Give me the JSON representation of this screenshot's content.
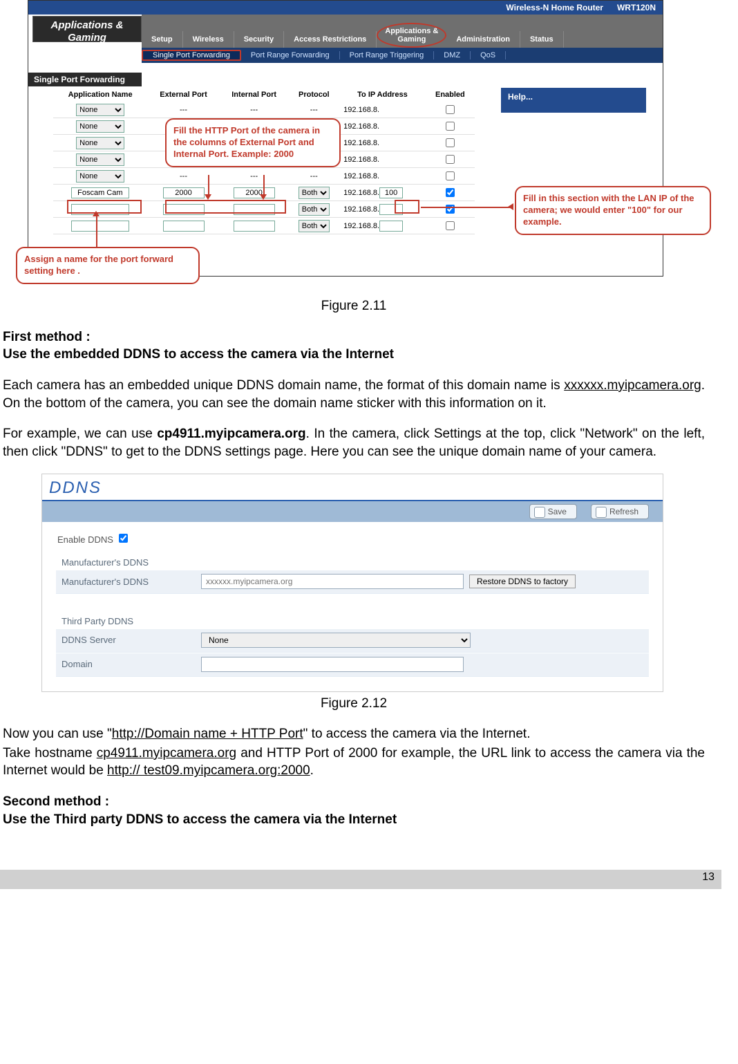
{
  "router": {
    "product_line": "Wireless-N Home Router",
    "model": "WRT120N",
    "section_title": "Applications & Gaming",
    "main_tabs": [
      "Setup",
      "Wireless",
      "Security",
      "Access Restrictions",
      "Applications &\nGaming",
      "Administration",
      "Status"
    ],
    "main_tab_active": 4,
    "sub_tabs": [
      "Single Port Forwarding",
      "Port Range Forwarding",
      "Port Range Triggering",
      "DMZ",
      "QoS"
    ],
    "sub_tab_active": 0,
    "panel_title": "Single Port Forwarding",
    "help_label": "Help...",
    "columns": [
      "Application Name",
      "External Port",
      "Internal Port",
      "Protocol",
      "To IP Address",
      "Enabled"
    ],
    "none_option": "None",
    "dash": "---",
    "both_option": "Both",
    "ip_prefix": "192.168.8.",
    "rows": {
      "none_count": 5,
      "custom": {
        "name": "Foscam Cam",
        "ext_port": "2000",
        "int_port": "2000",
        "protocol": "Both",
        "ip_end": "100",
        "enabled": true
      },
      "extra": [
        {
          "protocol": "Both",
          "enabled": true
        },
        {
          "protocol": "Both",
          "enabled": false
        }
      ]
    },
    "callouts": {
      "ports": "Fill the HTTP Port of the camera in the columns of External Port and Internal Port. Example: 2000",
      "name": "Assign a name for the port forward setting here .",
      "ip": "Fill in this section with the LAN IP of the camera; we would enter \"100\" for our example."
    }
  },
  "captions": {
    "fig211": "Figure 2.11",
    "fig212": "Figure 2.12"
  },
  "text": {
    "first_method": "First method :",
    "first_title": "Use the embedded DDNS to access the camera via the Internet",
    "p1a": "Each camera has an embedded unique DDNS domain name, the format of this domain name is ",
    "p1_domain": "xxxxxx.myipcamera.org",
    "p1b": ". On the bottom of the camera, you can see the domain name sticker with this information on it.",
    "p2a": "For example, we can use ",
    "p2_host": "cp4911.myipcamera.org",
    "p2b": ". In the camera, click Settings at the top, click \"Network\" on the left, then click \"DDNS\" to get to the DDNS settings page. Here you can see the unique domain name of your camera.",
    "p3a": "Now you can use \"",
    "p3_u": "http://Domain name + HTTP Port",
    "p3b": "\" to access the camera via the Internet.",
    "p4a": "Take hostname ",
    "p4_host": "cp4911.myipcamera.org",
    "p4b": " and HTTP Port of 2000 for example, the URL link to access the camera via the Internet would be ",
    "p4_url": "http:// test09.myipcamera.org:2000",
    "p4c": ".",
    "second_method": "Second method :",
    "second_title": "Use the Third party DDNS to access the camera via the Internet"
  },
  "ddns": {
    "title": "DDNS",
    "save": "Save",
    "refresh": "Refresh",
    "enable_label": "Enable DDNS",
    "enable_checked": true,
    "manuf_section": "Manufacturer's DDNS",
    "manuf_label": "Manufacturer's DDNS",
    "manuf_placeholder": "xxxxxx.myipcamera.org",
    "restore_btn": "Restore DDNS to factory",
    "third_section": "Third Party DDNS",
    "server_label": "DDNS Server",
    "server_value": "None",
    "domain_label": "Domain",
    "domain_value": ""
  },
  "page_number": "13"
}
